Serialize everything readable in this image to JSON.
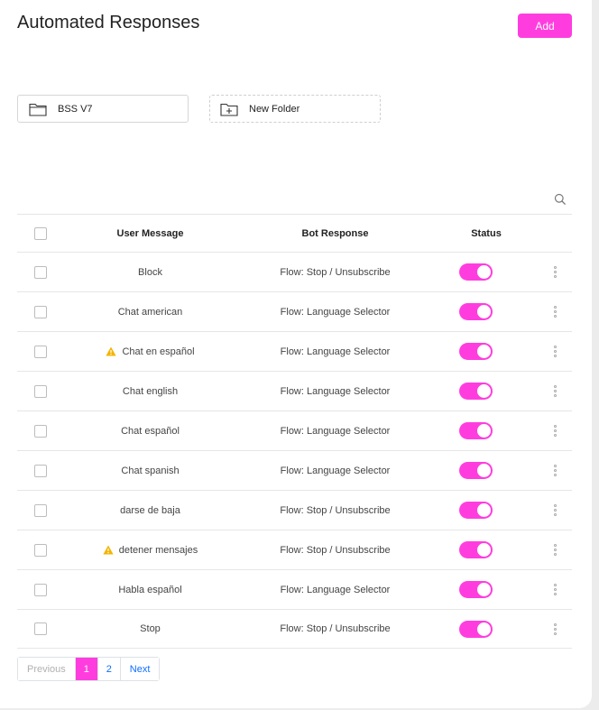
{
  "page": {
    "title": "Automated Responses",
    "add_label": "Add"
  },
  "folders": [
    {
      "label": "BSS V7",
      "icon": "folder-icon"
    },
    {
      "label": "New Folder",
      "icon": "folder-plus-icon"
    }
  ],
  "table": {
    "headers": {
      "user_message": "User Message",
      "bot_response": "Bot Response",
      "status": "Status"
    },
    "rows": [
      {
        "user_message": "Block",
        "bot_response": "Flow: Stop / Unsubscribe",
        "status": "on",
        "warning": false
      },
      {
        "user_message": "Chat american",
        "bot_response": "Flow: Language Selector",
        "status": "on",
        "warning": false
      },
      {
        "user_message": "Chat en español",
        "bot_response": "Flow: Language Selector",
        "status": "on",
        "warning": true
      },
      {
        "user_message": "Chat english",
        "bot_response": "Flow: Language Selector",
        "status": "on",
        "warning": false
      },
      {
        "user_message": "Chat español",
        "bot_response": "Flow: Language Selector",
        "status": "on",
        "warning": false
      },
      {
        "user_message": "Chat spanish",
        "bot_response": "Flow: Language Selector",
        "status": "on",
        "warning": false
      },
      {
        "user_message": "darse de baja",
        "bot_response": "Flow: Stop / Unsubscribe",
        "status": "on",
        "warning": false
      },
      {
        "user_message": "detener mensajes",
        "bot_response": "Flow: Stop / Unsubscribe",
        "status": "on",
        "warning": true
      },
      {
        "user_message": "Habla español",
        "bot_response": "Flow: Language Selector",
        "status": "on",
        "warning": false
      },
      {
        "user_message": "Stop",
        "bot_response": "Flow: Stop / Unsubscribe",
        "status": "on",
        "warning": false
      }
    ]
  },
  "pagination": {
    "previous": "Previous",
    "pages": [
      "1",
      "2"
    ],
    "current": "1",
    "next": "Next"
  },
  "colors": {
    "accent": "#ff3ddf",
    "warning": "#f5b400",
    "link": "#0d6efd"
  }
}
